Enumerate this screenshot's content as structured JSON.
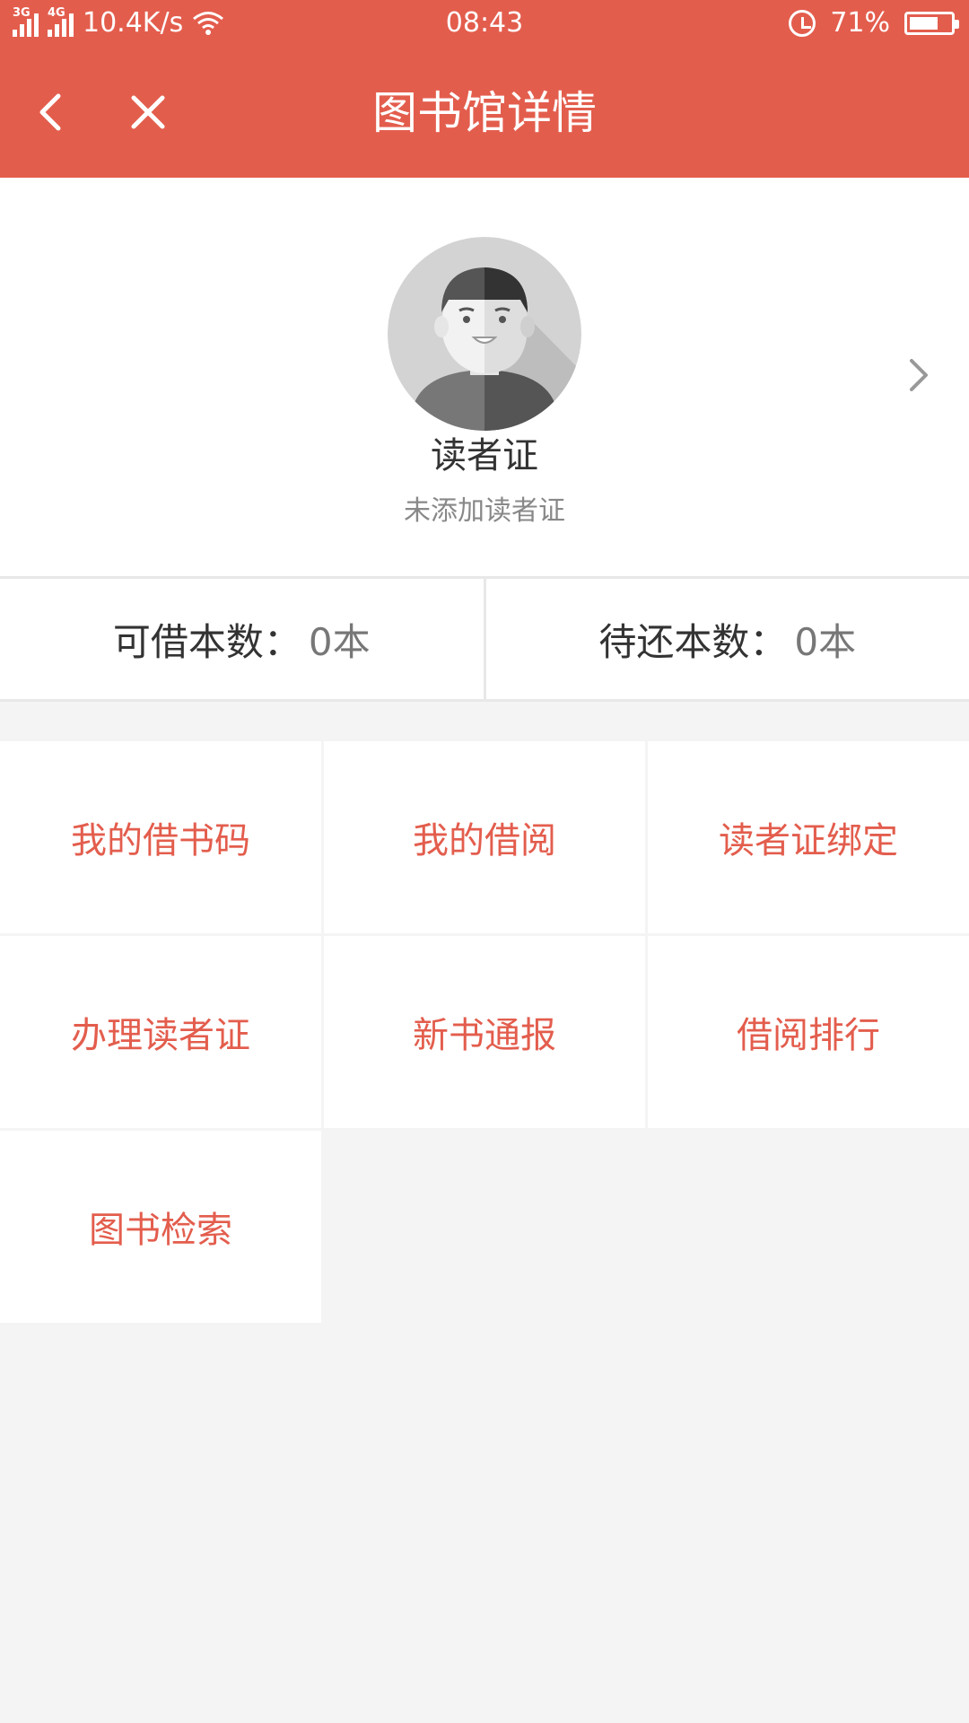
{
  "status_bar": {
    "network1": "3G",
    "network2": "4G",
    "speed": "10.4K/s",
    "time": "08:43",
    "battery_text": "71%",
    "battery_level": 0.71,
    "icons": [
      "signal-icon",
      "wifi-icon",
      "alarm-icon",
      "battery-icon"
    ]
  },
  "header": {
    "title": "图书馆详情",
    "back_icon": "chevron-left-icon",
    "close_icon": "close-icon"
  },
  "profile": {
    "title": "读者证",
    "subtitle": "未添加读者证",
    "chevron_icon": "chevron-right-icon"
  },
  "stats": [
    {
      "label": "可借本数：",
      "value": "0本"
    },
    {
      "label": "待还本数：",
      "value": "0本"
    }
  ],
  "menu": [
    {
      "label": "我的借书码"
    },
    {
      "label": "我的借阅"
    },
    {
      "label": "读者证绑定"
    },
    {
      "label": "办理读者证"
    },
    {
      "label": "新书通报"
    },
    {
      "label": "借阅排行"
    },
    {
      "label": "图书检索"
    }
  ],
  "colors": {
    "brand": "#e35d4d",
    "background": "#f4f4f4",
    "text": "#333333",
    "muted": "#888888"
  }
}
